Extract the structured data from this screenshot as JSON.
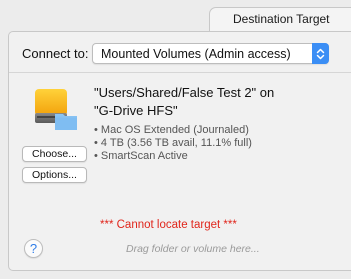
{
  "tab": {
    "label": "Destination Target"
  },
  "connect": {
    "label": "Connect to:",
    "selected": "Mounted Volumes (Admin access)",
    "arrows_icon": "up-down-chevrons-icon",
    "accent_color": "#3b8ef5"
  },
  "target": {
    "icon": "hard-drive-folder-icon",
    "title": "\"Users/Shared/False Test 2\" on \"G-Drive HFS\"",
    "details": [
      "• Mac OS Extended (Journaled)",
      "• 4 TB (3.56 TB avail, 11.1% full)",
      "• SmartScan Active"
    ]
  },
  "buttons": {
    "choose": "Choose...",
    "options": "Options..."
  },
  "status": {
    "text": "*** Cannot locate target ***",
    "color": "#e0261c"
  },
  "footer": {
    "help_label": "?",
    "drop_hint": "Drag folder or volume here..."
  }
}
